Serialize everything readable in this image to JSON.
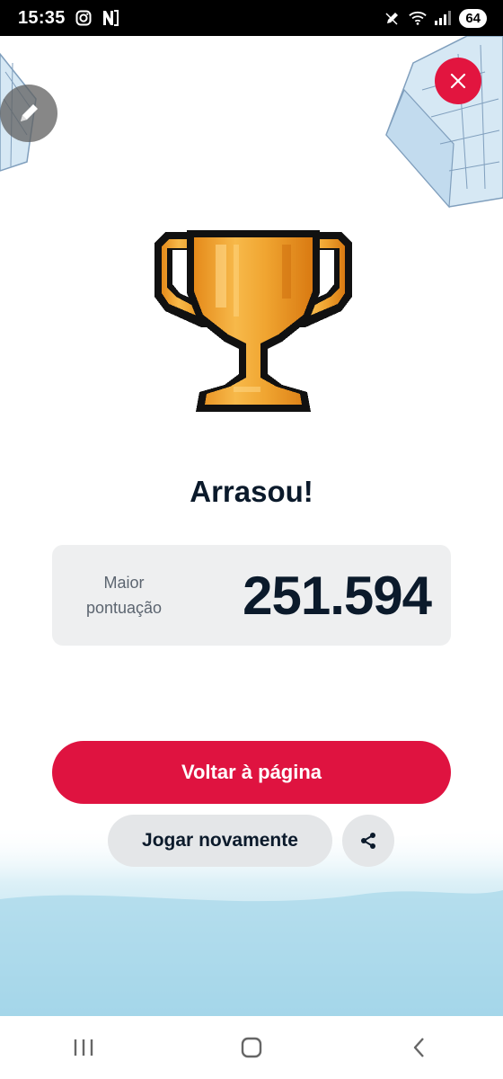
{
  "status_bar": {
    "time": "15:35",
    "battery": "64",
    "icons": [
      "instagram-icon",
      "app-notification-icon",
      "pen-icon",
      "wifi-icon",
      "signal-icon"
    ]
  },
  "result": {
    "headline": "Arrasou!",
    "score_label_line1": "Maior",
    "score_label_line2": "pontuação",
    "score_value": "251.594"
  },
  "actions": {
    "primary_label": "Voltar à página",
    "secondary_label": "Jogar novamente",
    "share_icon": "share-icon",
    "close_icon": "close-icon",
    "edit_icon": "pencil-icon"
  },
  "nav": {
    "icons": [
      "recent-apps-icon",
      "home-icon",
      "back-icon"
    ]
  },
  "colors": {
    "accent": "#df1340",
    "text": "#0b1a2b",
    "card_bg": "#eeeff0",
    "secondary_bg": "#e4e6e8",
    "trophy_gold": "#f0a531"
  }
}
